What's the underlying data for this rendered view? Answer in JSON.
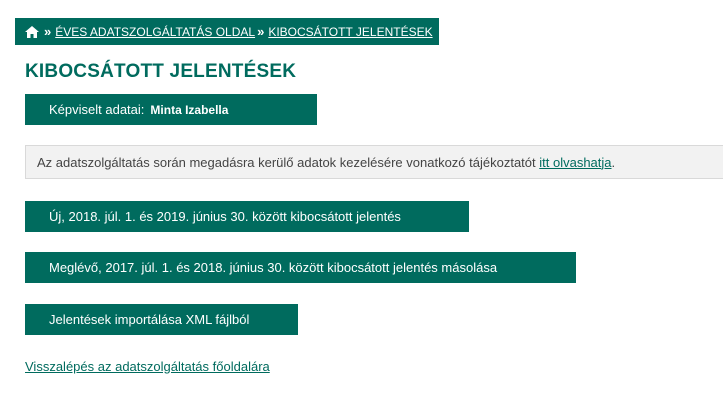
{
  "breadcrumb": {
    "home_icon": "home-icon",
    "separator": "»",
    "items": [
      {
        "label": "ÉVES ADATSZOLGÁLTATÁS OLDAL"
      },
      {
        "label": "KIBOCSÁTOTT JELENTÉSEK"
      }
    ]
  },
  "page": {
    "title": "KIBOCSÁTOTT JELENTÉSEK"
  },
  "represented": {
    "label": "Képviselt adatai:",
    "name": "Minta Izabella"
  },
  "notice": {
    "text": "Az adatszolgáltatás során megadásra kerülő adatok kezelésére vonatkozó tájékoztatót ",
    "link_label": "itt olvashatja",
    "suffix": "."
  },
  "actions": {
    "new_report": "Új, 2018. júl. 1. és 2019. június 30. között kibocsátott jelentés",
    "copy_report": "Meglévő, 2017. júl. 1. és 2018. június 30. között kibocsátott jelentés másolása",
    "import_xml": "Jelentések importálása XML fájlból"
  },
  "back_link": "Visszalépés az adatszolgáltatás főoldalára",
  "colors": {
    "brand": "#006b5e",
    "notice_bg": "#f2f2f2",
    "text": "#444444"
  }
}
